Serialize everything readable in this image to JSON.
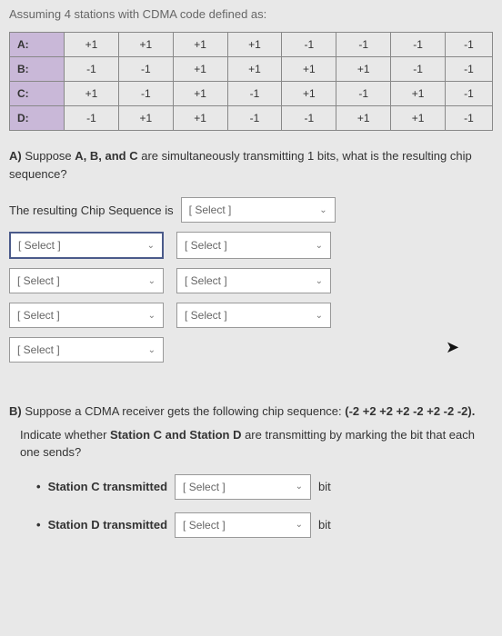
{
  "intro": "Assuming 4 stations with CDMA code defined as:",
  "table": {
    "rows": [
      {
        "label": "A:",
        "vals": [
          "+1",
          "+1",
          "+1",
          "+1",
          "-1",
          "-1",
          "-1",
          "-1"
        ]
      },
      {
        "label": "B:",
        "vals": [
          "-1",
          "-1",
          "+1",
          "+1",
          "+1",
          "+1",
          "-1",
          "-1"
        ]
      },
      {
        "label": "C:",
        "vals": [
          "+1",
          "-1",
          "+1",
          "-1",
          "+1",
          "-1",
          "+1",
          "-1"
        ]
      },
      {
        "label": "D:",
        "vals": [
          "-1",
          "+1",
          "+1",
          "-1",
          "-1",
          "+1",
          "+1",
          "-1"
        ]
      }
    ]
  },
  "partA": {
    "prefix": "A) ",
    "text1": "Suppose ",
    "bold": "A, B, and C",
    "text2": " are simultaneously transmitting 1 bits, what is the resulting chip sequence?",
    "result_label": "The resulting Chip Sequence is",
    "select_placeholder": "[ Select ]"
  },
  "partB": {
    "prefix": "B) ",
    "text1": "Suppose a CDMA receiver gets the following chip sequence: ",
    "seq": "(-2 +2 +2 +2 -2 +2 -2 -2).",
    "text2": "Indicate whether ",
    "bold2": "Station C and Station D",
    "text3": " are transmitting by marking the bit that each one sends?",
    "bullet": "•",
    "stationC": "Station C transmitted",
    "stationD": "Station D transmitted",
    "bit": "bit",
    "select_placeholder": "[ Select ]"
  }
}
